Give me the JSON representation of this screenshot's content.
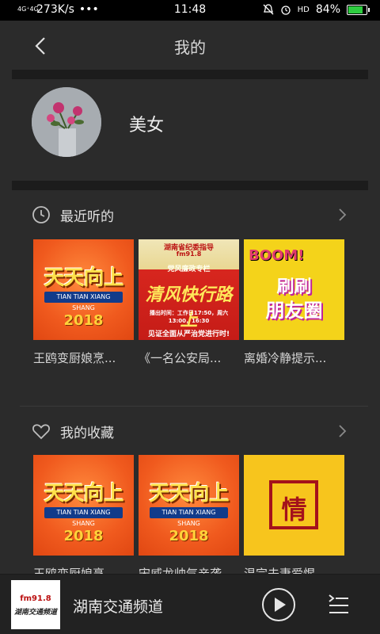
{
  "status_bar": {
    "network": "4G⁺4G",
    "speed": "273K/s",
    "dots": "•••",
    "time": "11:48",
    "battery": "84%",
    "battery_level": 0.84
  },
  "header": {
    "title": "我的"
  },
  "profile": {
    "username": "美女"
  },
  "recent": {
    "title": "最近听的",
    "items": [
      {
        "title": "王鸥变厨娘烹...",
        "cover_lines": [
          "天天向上",
          "TIAN TIAN XIANG SHANG",
          "2018"
        ]
      },
      {
        "title": "《一名公安局...",
        "cover_lines": [
          "湖南省纪委指导",
          "fm91.8",
          "党风廉政专栏",
          "清风快行路上",
          "播出时间：工作日17:50，周六13:00，16:30",
          "见证全面从严治党进行时!"
        ]
      },
      {
        "title": "离婚冷静提示...",
        "cover_lines": [
          "BOOM!",
          "刷刷",
          "朋友圈"
        ]
      }
    ]
  },
  "favorites": {
    "title": "我的收藏",
    "items": [
      {
        "title": "王鸥变厨娘烹...",
        "cover_lines": [
          "天天向上",
          "TIAN TIAN XIANG SHANG",
          "2018"
        ]
      },
      {
        "title": "宋威龙帅气亲袭...",
        "cover_lines": [
          "天天向上",
          "TIAN TIAN XIANG SHANG",
          "2018"
        ]
      },
      {
        "title": "温完夫妻爱惺...",
        "cover_lines": [
          "情"
        ]
      }
    ]
  },
  "player": {
    "thumb_line1": "fm91.8",
    "thumb_line2": "湖南交通频道",
    "station": "湖南交通频道"
  }
}
